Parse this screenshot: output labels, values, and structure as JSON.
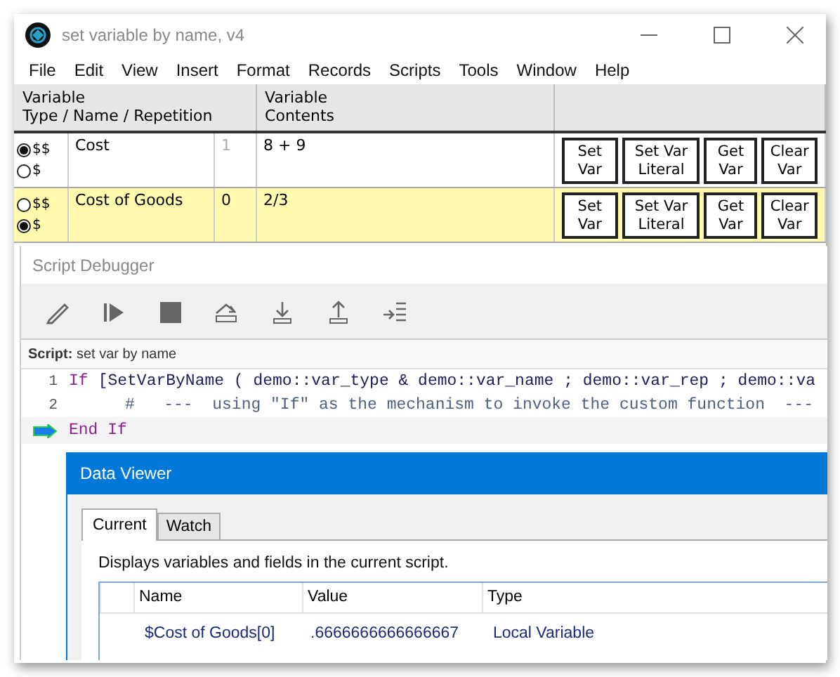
{
  "window": {
    "title": "set variable by name, v4"
  },
  "menu": [
    "File",
    "Edit",
    "View",
    "Insert",
    "Format",
    "Records",
    "Scripts",
    "Tools",
    "Window",
    "Help"
  ],
  "table": {
    "columns": [
      {
        "lines": [
          "Variable",
          "Type / Name / Repetition"
        ]
      },
      {
        "lines": [
          "Variable",
          "Contents"
        ]
      }
    ],
    "rows": [
      {
        "highlighted": false,
        "type_options": [
          {
            "label": "$$",
            "selected": true
          },
          {
            "label": "$",
            "selected": false
          }
        ],
        "name": "Cost",
        "repetition_placeholder": "1",
        "contents": "8 + 9",
        "buttons": [
          [
            "Set",
            "Var"
          ],
          [
            "Set Var",
            "Literal"
          ],
          [
            "Get",
            "Var"
          ],
          [
            "Clear",
            "Var"
          ]
        ]
      },
      {
        "highlighted": true,
        "type_options": [
          {
            "label": "$$",
            "selected": false
          },
          {
            "label": "$",
            "selected": true
          }
        ],
        "name": "Cost of Goods",
        "repetition": "0",
        "contents": "2/3",
        "buttons": [
          [
            "Set",
            "Var"
          ],
          [
            "Set Var",
            "Literal"
          ],
          [
            "Get",
            "Var"
          ],
          [
            "Clear",
            "Var"
          ]
        ]
      }
    ]
  },
  "debugger": {
    "title": "Script Debugger",
    "script_label": "**Script:** set var by name",
    "lines": [
      {
        "number": "1",
        "current": false,
        "segments": [
          {
            "kind": "keyword",
            "text": "If"
          },
          {
            "kind": "text",
            "text": "[SetVarByName ( demo::var_type & demo::var_name ; demo::var_rep ; demo::va"
          }
        ],
        "children": [
          {
            "number": "2",
            "current": false,
            "segments": [
              {
                "kind": "comment",
                "text": "#   ---  using \"If\" as the mechanism to invoke the custom function  ---"
              }
            ]
          }
        ]
      },
      {
        "current": true,
        "segments": [
          {
            "kind": "keyword",
            "text": "End If"
          }
        ]
      }
    ]
  },
  "data_viewer": {
    "title": "Data Viewer",
    "tabs": [
      {
        "label": "Current",
        "selected": true
      },
      {
        "label": "Watch",
        "selected": false
      }
    ],
    "description": "Displays variables and fields in the current script.",
    "columns": [
      "Name",
      "Value",
      "Type"
    ],
    "rows": [
      {
        "name": "$Cost of Goods[0]",
        "value": ".6666666666666667",
        "type": "Local Variable"
      }
    ]
  }
}
